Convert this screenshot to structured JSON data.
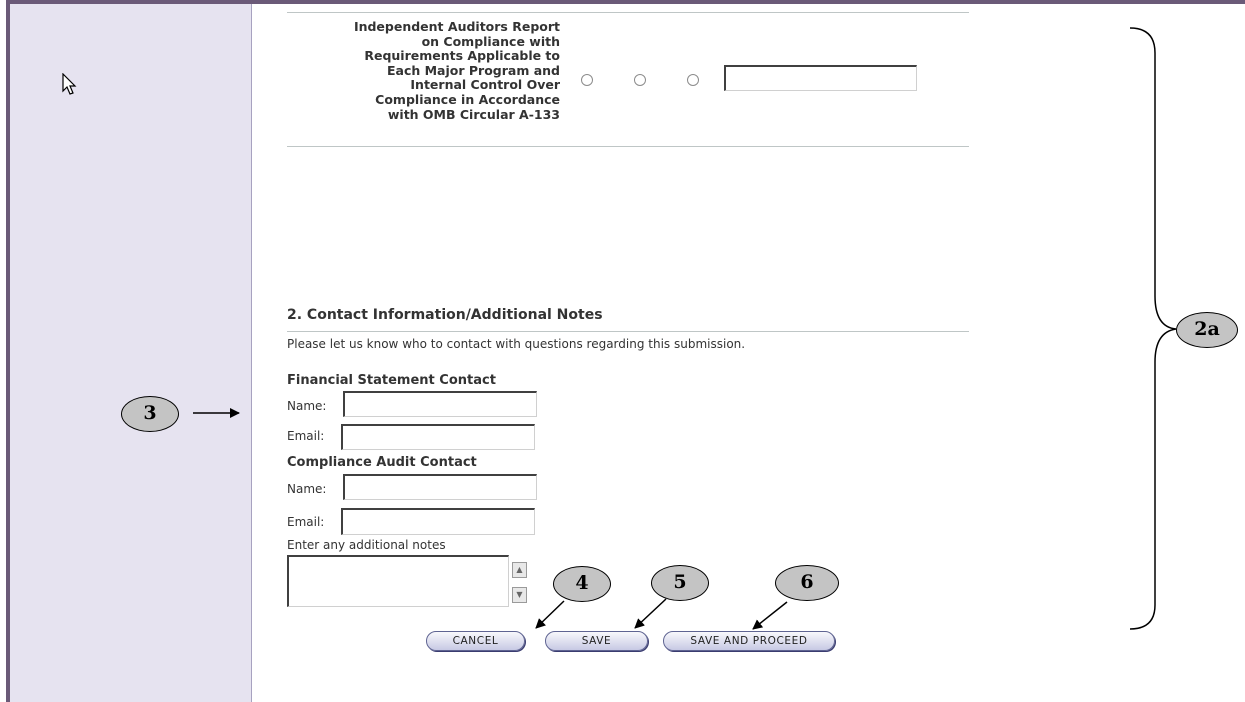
{
  "report": {
    "text_lines": [
      "Independent Auditors Report",
      "on Compliance with",
      "Requirements Applicable to",
      "Each Major Program and",
      "Internal Control Over",
      "Compliance in Accordance",
      "with OMB Circular A-133"
    ],
    "comment_value": ""
  },
  "contact_section": {
    "title": "2. Contact Information/Additional Notes",
    "instructions": "Please let us know who to contact with questions regarding this submission.",
    "financial": {
      "heading": "Financial Statement Contact",
      "name_label": "Name:",
      "name_value": "",
      "email_label": "Email:",
      "email_value": ""
    },
    "compliance": {
      "heading": "Compliance Audit Contact",
      "name_label": "Name:",
      "name_value": "",
      "email_label": "Email:",
      "email_value": ""
    },
    "notes_label": "Enter any additional notes",
    "notes_value": ""
  },
  "buttons": {
    "cancel": "CANCEL",
    "save": "SAVE",
    "save_and_proceed": "SAVE AND PROCEED"
  },
  "callouts": {
    "c3": "3",
    "c4": "4",
    "c5": "5",
    "c6": "6",
    "c2a": "2a"
  },
  "colors": {
    "sidebar": "#e6e3f0",
    "frame": "#6b5a78",
    "button_border": "#5f6492",
    "callout_fill": "#c4c4c4"
  },
  "icons": {
    "cursor": "mouse-pointer-icon",
    "scroll_up": "scroll-up-arrow-icon",
    "scroll_down": "scroll-down-arrow-icon"
  }
}
